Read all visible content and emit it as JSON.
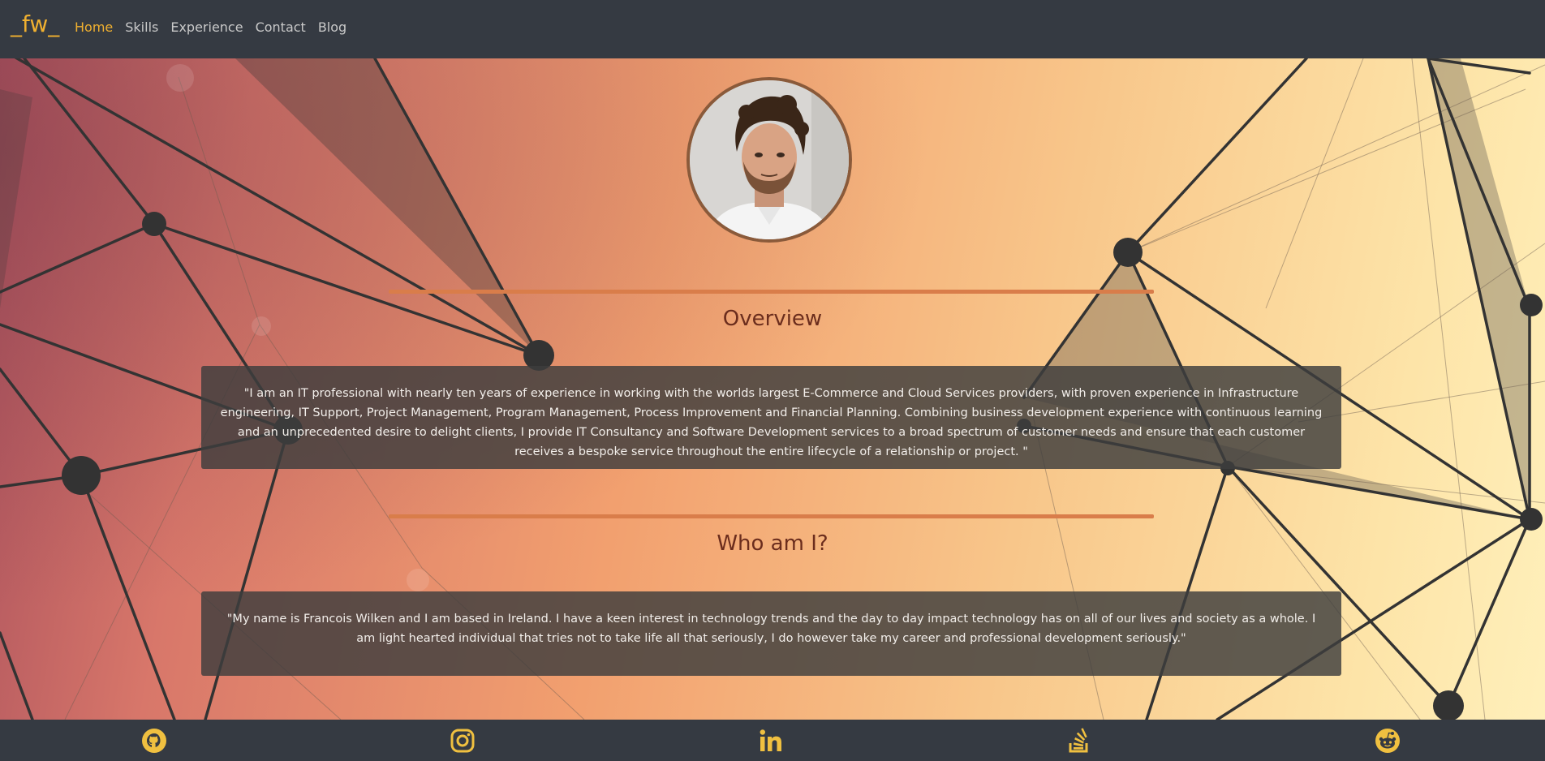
{
  "brand": {
    "logo": "_fw_"
  },
  "nav": {
    "items": [
      {
        "label": "Home",
        "active": true
      },
      {
        "label": "Skills",
        "active": false
      },
      {
        "label": "Experience",
        "active": false
      },
      {
        "label": "Contact",
        "active": false
      },
      {
        "label": "Blog",
        "active": false
      }
    ]
  },
  "overview": {
    "title": "Overview",
    "text": "\"I am an IT professional with nearly ten years of experience in working with the worlds largest E-Commerce and Cloud Services providers, with proven experience in Infrastructure engineering, IT Support, Project Management, Program Management, Process Improvement and Financial Planning. Combining business development experience with continuous learning and an unprecedented desire to delight clients, I provide IT Consultancy and Software Development services to a broad spectrum of customer needs and ensure that each customer receives a bespoke service throughout the entire lifecycle of a relationship or project. \""
  },
  "about": {
    "title": "Who am I?",
    "text": "\"My name is Francois Wilken and I am based in Ireland. I have a keen interest in technology trends and the day to day impact technology has on all of our lives and society as a whole. I am light hearted individual that tries not to take life all that seriously, I do however take my career and professional development seriously.\""
  },
  "social": {
    "icons": [
      "github-icon",
      "instagram-icon",
      "linkedin-icon",
      "stackoverflow-icon",
      "reddit-icon"
    ]
  },
  "colors": {
    "nav_bg": "#353a42",
    "accent": "#f0b030",
    "heading": "#6b2d1d",
    "card_bg": "#3d3d3d",
    "rule": "#d97d4a"
  }
}
